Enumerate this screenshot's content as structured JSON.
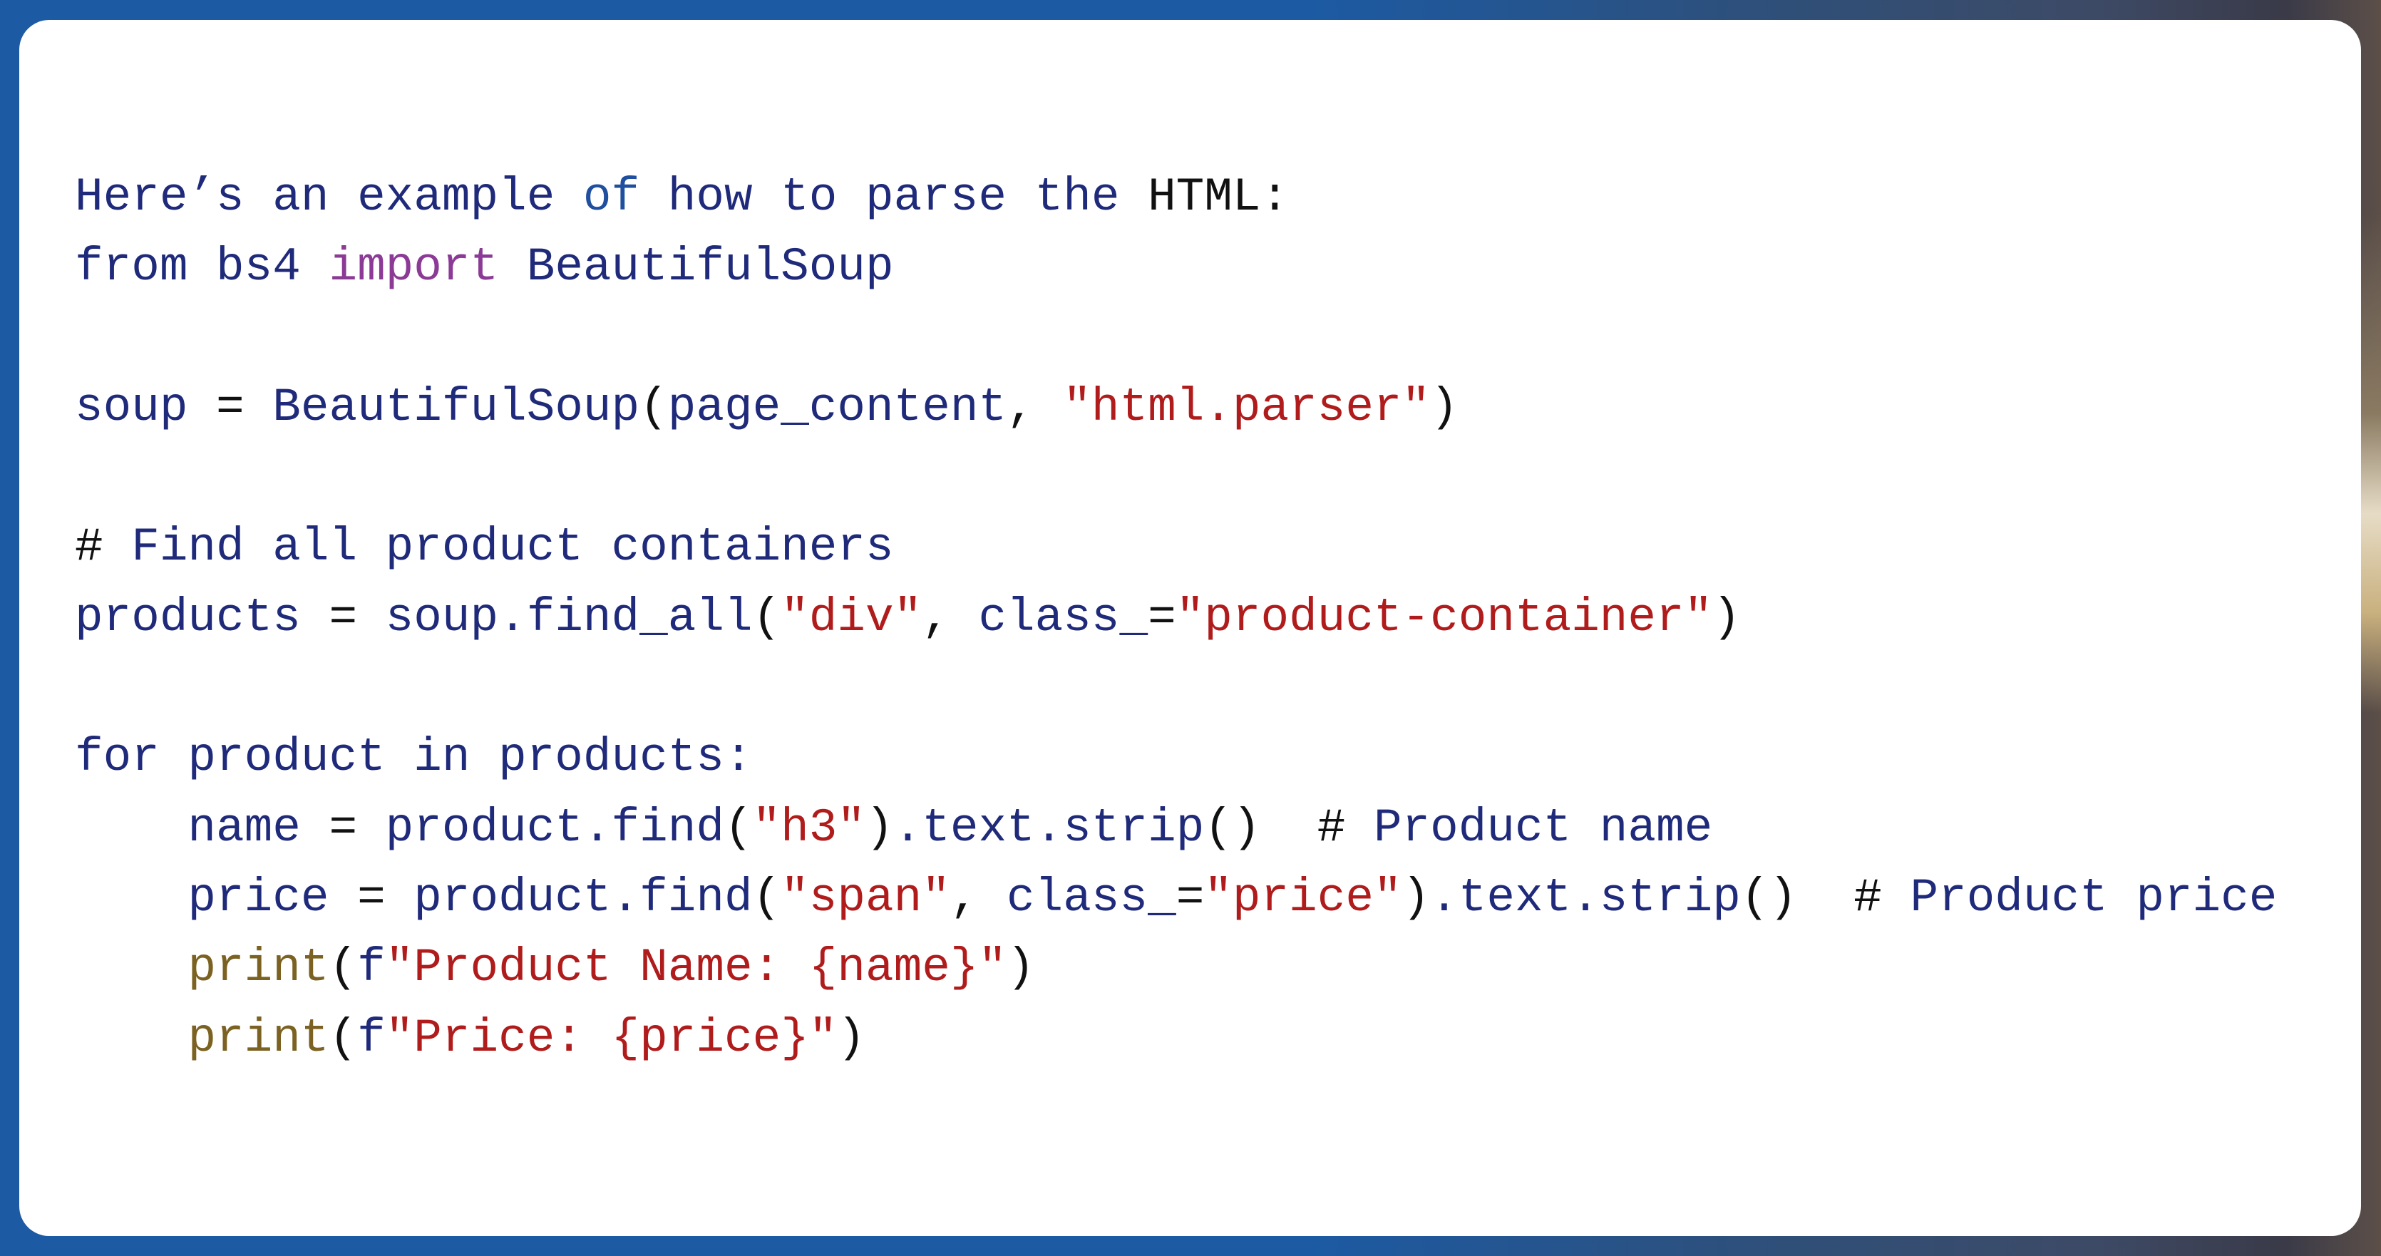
{
  "colors": {
    "background": "#1c5aa3",
    "card": "#ffffff",
    "identifier": "#1f2a7a",
    "keyword_import": "#8b3a96",
    "string": "#b01c1c",
    "builtin_print": "#7b6222",
    "operator": "#111111"
  },
  "code_block": {
    "language": "python",
    "lines": [
      [
        {
          "t": "Here’s an example ",
          "c": "intro"
        },
        {
          "t": "of",
          "c": "of"
        },
        {
          "t": " how to parse the ",
          "c": "intro"
        },
        {
          "t": "HTML:",
          "c": "plain"
        }
      ],
      [
        {
          "t": "from bs4 ",
          "c": "intro"
        },
        {
          "t": "import",
          "c": "import"
        },
        {
          "t": " BeautifulSoup",
          "c": "intro"
        }
      ],
      [],
      [
        {
          "t": "soup ",
          "c": "intro"
        },
        {
          "t": "=",
          "c": "op"
        },
        {
          "t": " BeautifulSoup",
          "c": "intro"
        },
        {
          "t": "(",
          "c": "op"
        },
        {
          "t": "page_content",
          "c": "intro"
        },
        {
          "t": ", ",
          "c": "op"
        },
        {
          "t": "\"html.parser\"",
          "c": "str"
        },
        {
          "t": ")",
          "c": "op"
        }
      ],
      [],
      [
        {
          "t": "# ",
          "c": "op"
        },
        {
          "t": "Find all product containers",
          "c": "intro"
        }
      ],
      [
        {
          "t": "products ",
          "c": "intro"
        },
        {
          "t": "=",
          "c": "op"
        },
        {
          "t": " soup.find_all",
          "c": "intro"
        },
        {
          "t": "(",
          "c": "op"
        },
        {
          "t": "\"div\"",
          "c": "str"
        },
        {
          "t": ", ",
          "c": "op"
        },
        {
          "t": "class_",
          "c": "intro"
        },
        {
          "t": "=",
          "c": "op"
        },
        {
          "t": "\"product-container\"",
          "c": "str"
        },
        {
          "t": ")",
          "c": "op"
        }
      ],
      [],
      [
        {
          "t": "for product in products:",
          "c": "intro"
        }
      ],
      [
        {
          "t": "    name ",
          "c": "intro"
        },
        {
          "t": "=",
          "c": "op"
        },
        {
          "t": " product.find",
          "c": "intro"
        },
        {
          "t": "(",
          "c": "op"
        },
        {
          "t": "\"h3\"",
          "c": "str"
        },
        {
          "t": ")",
          "c": "op"
        },
        {
          "t": ".text.strip",
          "c": "intro"
        },
        {
          "t": "()",
          "c": "op"
        },
        {
          "t": "  # ",
          "c": "op"
        },
        {
          "t": "Product name",
          "c": "intro"
        }
      ],
      [
        {
          "t": "    price ",
          "c": "intro"
        },
        {
          "t": "=",
          "c": "op"
        },
        {
          "t": " product.find",
          "c": "intro"
        },
        {
          "t": "(",
          "c": "op"
        },
        {
          "t": "\"span\"",
          "c": "str"
        },
        {
          "t": ", ",
          "c": "op"
        },
        {
          "t": "class_",
          "c": "intro"
        },
        {
          "t": "=",
          "c": "op"
        },
        {
          "t": "\"price\"",
          "c": "str"
        },
        {
          "t": ")",
          "c": "op"
        },
        {
          "t": ".text.strip",
          "c": "intro"
        },
        {
          "t": "()",
          "c": "op"
        },
        {
          "t": "  # ",
          "c": "op"
        },
        {
          "t": "Product price",
          "c": "intro"
        }
      ],
      [
        {
          "t": "    ",
          "c": "intro"
        },
        {
          "t": "print",
          "c": "print"
        },
        {
          "t": "(",
          "c": "op"
        },
        {
          "t": "f",
          "c": "intro"
        },
        {
          "t": "\"Product Name: {name}\"",
          "c": "str"
        },
        {
          "t": ")",
          "c": "op"
        }
      ],
      [
        {
          "t": "    ",
          "c": "intro"
        },
        {
          "t": "print",
          "c": "print"
        },
        {
          "t": "(",
          "c": "op"
        },
        {
          "t": "f",
          "c": "intro"
        },
        {
          "t": "\"Price: {price}\"",
          "c": "str"
        },
        {
          "t": ")",
          "c": "op"
        }
      ]
    ]
  }
}
